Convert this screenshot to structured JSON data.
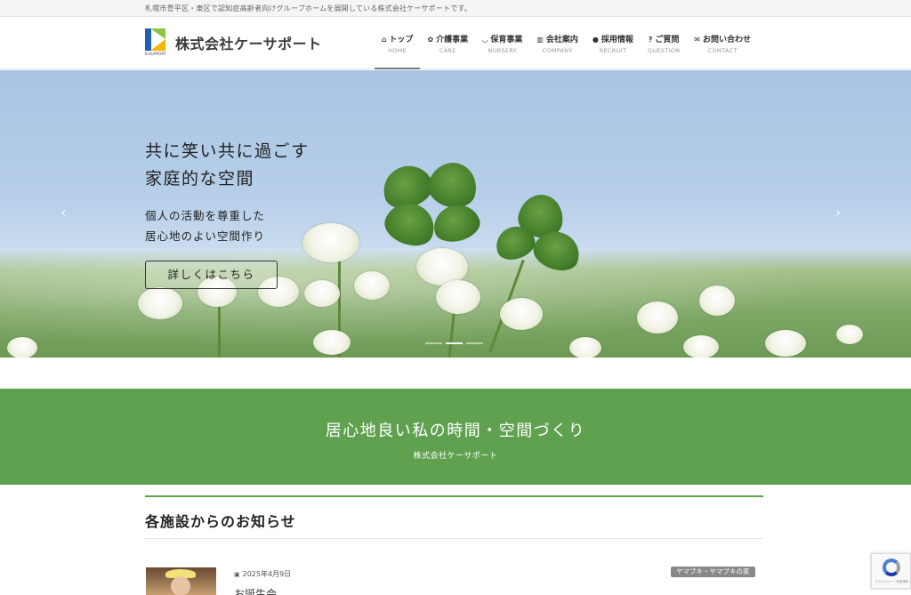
{
  "topbar": {
    "text": "札幌市豊平区・東区で認知症高齢者向けグループホームを展開している株式会社ケーサポートです。"
  },
  "header": {
    "logo_sub": "K-SUPPORT",
    "logo_name": "株式会社ケーサポート",
    "nav": [
      {
        "icon": "home-icon",
        "glyph": "⌂",
        "label": "トップ",
        "en": "HOME"
      },
      {
        "icon": "care-icon",
        "glyph": "✿",
        "label": "介護事業",
        "en": "CARE"
      },
      {
        "icon": "nursery-icon",
        "glyph": "◡",
        "label": "保育事業",
        "en": "NURSERY"
      },
      {
        "icon": "building-icon",
        "glyph": "▥",
        "label": "会社案内",
        "en": "COMPANY"
      },
      {
        "icon": "lightbulb-icon",
        "glyph": "●",
        "label": "採用情報",
        "en": "RECRUIT"
      },
      {
        "icon": "question-icon",
        "glyph": "?",
        "label": "ご質問",
        "en": "QUESTION"
      },
      {
        "icon": "mail-icon",
        "glyph": "✉",
        "label": "お問い合わせ",
        "en": "CONTACT"
      }
    ]
  },
  "hero": {
    "title_line1": "共に笑い共に過ごす",
    "title_line2": "家庭的な空間",
    "sub_line1": "個人の活動を尊重した",
    "sub_line2": "居心地のよい空間作り",
    "button": "詳しくはこちら",
    "prev_glyph": "‹",
    "next_glyph": "›",
    "slide_count": 3,
    "active_slide": 1
  },
  "banner": {
    "title": "居心地良い私の時間・空間づくり",
    "sub": "株式会社ケーサポート"
  },
  "news": {
    "heading": "各施設からのお知らせ",
    "items": [
      {
        "date": "2025年4月9日",
        "title": "お誕生会",
        "category": "ヤマブキ・ヤマブキの家"
      }
    ]
  },
  "recaptcha": {
    "text": "プライバシー・利用規約"
  },
  "colors": {
    "green": "#5fa14f",
    "logo_blue": "#2161b0",
    "logo_green": "#8cc63f",
    "logo_yellow": "#f2b705"
  }
}
